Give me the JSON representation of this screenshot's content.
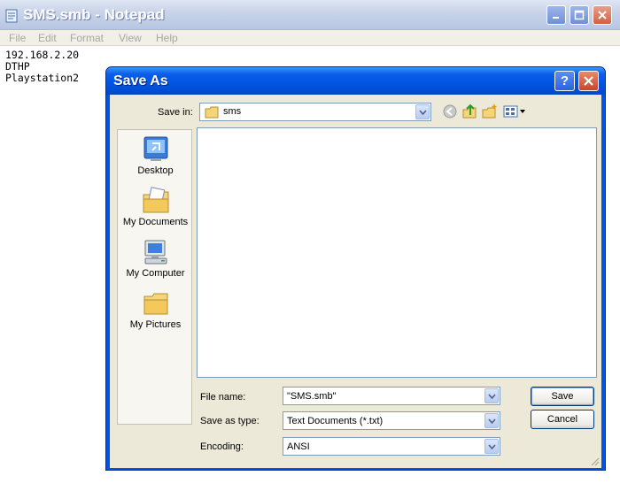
{
  "notepad": {
    "title": "SMS.smb - Notepad",
    "menu": [
      "File",
      "Edit",
      "Format",
      "View",
      "Help"
    ],
    "content_lines": [
      "192.168.2.20",
      "DTHP",
      "Playstation2"
    ]
  },
  "dialog": {
    "title": "Save As",
    "help_glyph": "?",
    "save_in": {
      "label": "Save in:",
      "value": "sms"
    },
    "places": [
      "Desktop",
      "My Documents",
      "My Computer",
      "My Pictures"
    ],
    "file_name": {
      "label": "File name:",
      "value": "\"SMS.smb\""
    },
    "save_as_type": {
      "label": "Save as type:",
      "value": "Text Documents (*.txt)"
    },
    "encoding": {
      "label": "Encoding:",
      "value": "ANSI"
    },
    "buttons": {
      "save": "Save",
      "cancel": "Cancel"
    }
  },
  "colors": {
    "xp_title_blue": "#0054e3",
    "dialog_face": "#ece9d8",
    "field_border": "#7f9db9",
    "close_red": "#c8452a"
  },
  "icons": {
    "notepad_app": "notepad-icon",
    "toolbar": [
      "back-icon",
      "up-folder-icon",
      "new-folder-icon",
      "views-menu-icon"
    ],
    "places": [
      "desktop-icon",
      "my-documents-icon",
      "my-computer-icon",
      "my-pictures-icon"
    ]
  }
}
